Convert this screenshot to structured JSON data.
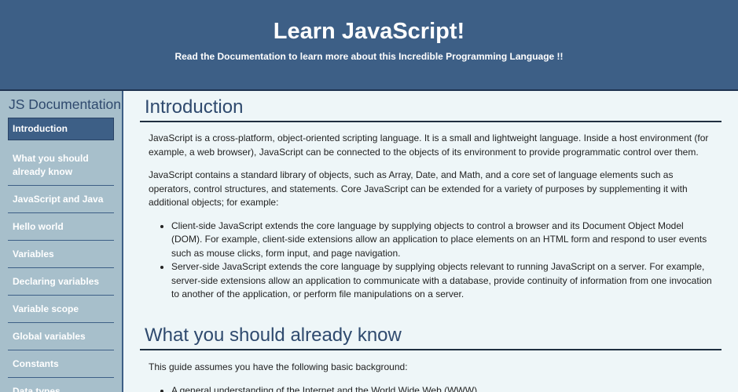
{
  "header": {
    "title": "Learn JavaScript!",
    "subtitle": "Read the Documentation to learn more about this Incredible Programming Language !!"
  },
  "sidebar": {
    "title": "JS Documentation",
    "items": [
      {
        "label": "Introduction",
        "active": true
      },
      {
        "label": "What you should already know"
      },
      {
        "label": "JavaScript and Java"
      },
      {
        "label": "Hello world"
      },
      {
        "label": "Variables"
      },
      {
        "label": "Declaring variables"
      },
      {
        "label": "Variable scope"
      },
      {
        "label": "Global variables"
      },
      {
        "label": "Constants"
      },
      {
        "label": "Data types"
      }
    ]
  },
  "main": {
    "sections": [
      {
        "heading": "Introduction",
        "paragraphs": [
          "JavaScript is a cross-platform, object-oriented scripting language. It is a small and lightweight language. Inside a host environment (for example, a web browser), JavaScript can be connected to the objects of its environment to provide programmatic control over them.",
          "JavaScript contains a standard library of objects, such as Array, Date, and Math, and a core set of language elements such as operators, control structures, and statements. Core JavaScript can be extended for a variety of purposes by supplementing it with additional objects; for example:"
        ],
        "bullets": [
          "Client-side JavaScript extends the core language by supplying objects to control a browser and its Document Object Model (DOM). For example, client-side extensions allow an application to place elements on an HTML form and respond to user events such as mouse clicks, form input, and page navigation.",
          "Server-side JavaScript extends the core language by supplying objects relevant to running JavaScript on a server. For example, server-side extensions allow an application to communicate with a database, provide continuity of information from one invocation to another of the application, or perform file manipulations on a server."
        ]
      },
      {
        "heading": "What you should already know",
        "paragraphs": [
          "This guide assumes you have the following basic background:"
        ],
        "bullets": [
          "A general understanding of the Internet and the World Wide Web (WWW)."
        ]
      }
    ]
  },
  "colors": {
    "header_bg": "#3d5f86",
    "sidebar_bg": "#a7bfcb",
    "page_bg": "#eef6f8",
    "heading_text": "#2f4a6e"
  }
}
